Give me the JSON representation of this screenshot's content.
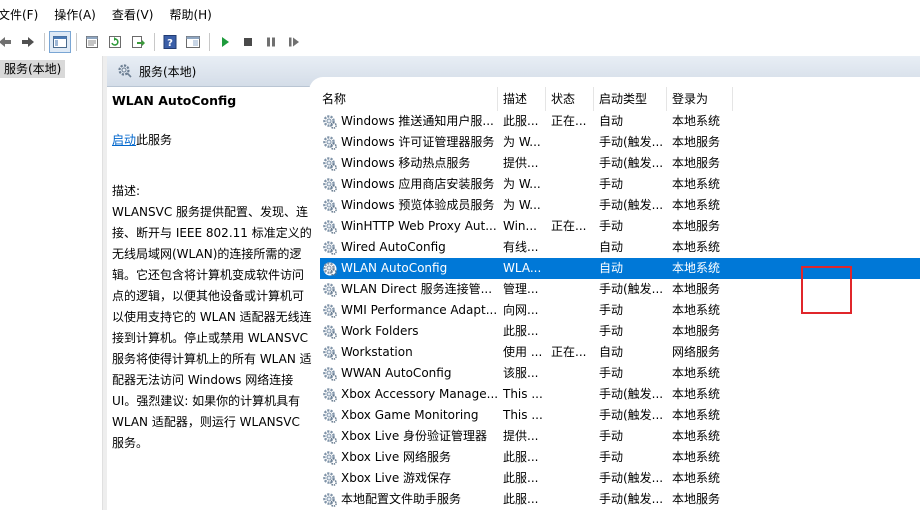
{
  "menubar": {
    "items": [
      "文件(F)",
      "操作(A)",
      "查看(V)",
      "帮助(H)"
    ]
  },
  "toolbar": {
    "icons": [
      "back-icon",
      "forward-icon",
      "show-tree-icon",
      "properties-icon",
      "refresh-icon",
      "export-icon",
      "help-icon",
      "console-icon",
      "play-icon",
      "stop-icon",
      "pause-icon",
      "restart-icon"
    ]
  },
  "tree": {
    "selected_item": "服务(本地)"
  },
  "panel": {
    "header_title": "服务(本地)"
  },
  "description_pane": {
    "service_title": "WLAN AutoConfig",
    "start_link": "启动",
    "start_suffix": "此服务",
    "description_label": "描述:",
    "description_text": "WLANSVC 服务提供配置、发现、连接、断开与 IEEE 802.11 标准定义的无线局域网(WLAN)的连接所需的逻辑。它还包含将计算机变成软件访问点的逻辑，以便其他设备或计算机可以使用支持它的 WLAN 适配器无线连接到计算机。停止或禁用 WLANSVC 服务将使得计算机上的所有 WLAN 适配器无法访问 Windows 网络连接 UI。强烈建议: 如果你的计算机具有 WLAN 适配器，则运行 WLANSVC 服务。"
  },
  "services_table": {
    "columns": [
      "名称",
      "描述",
      "状态",
      "启动类型",
      "登录为"
    ],
    "rows": [
      {
        "name": "Windows 推送通知用户服...",
        "desc": "此服...",
        "status": "正在...",
        "startup": "自动",
        "logon": "本地系统"
      },
      {
        "name": "Windows 许可证管理器服务",
        "desc": "为 W...",
        "status": "",
        "startup": "手动(触发...",
        "logon": "本地服务"
      },
      {
        "name": "Windows 移动热点服务",
        "desc": "提供...",
        "status": "",
        "startup": "手动(触发...",
        "logon": "本地服务"
      },
      {
        "name": "Windows 应用商店安装服务",
        "desc": "为 W...",
        "status": "",
        "startup": "手动",
        "logon": "本地系统"
      },
      {
        "name": "Windows 预览体验成员服务",
        "desc": "为 W...",
        "status": "",
        "startup": "手动(触发...",
        "logon": "本地系统"
      },
      {
        "name": "WinHTTP Web Proxy Aut...",
        "desc": "Win...",
        "status": "正在...",
        "startup": "手动",
        "logon": "本地服务"
      },
      {
        "name": "Wired AutoConfig",
        "desc": "有线...",
        "status": "",
        "startup": "自动",
        "logon": "本地系统"
      },
      {
        "name": "WLAN AutoConfig",
        "desc": "WLA...",
        "status": "",
        "startup": "自动",
        "logon": "本地系统",
        "selected": true
      },
      {
        "name": "WLAN Direct 服务连接管...",
        "desc": "管理...",
        "status": "",
        "startup": "手动(触发...",
        "logon": "本地服务"
      },
      {
        "name": "WMI Performance Adapt...",
        "desc": "向网...",
        "status": "",
        "startup": "手动",
        "logon": "本地系统"
      },
      {
        "name": "Work Folders",
        "desc": "此服...",
        "status": "",
        "startup": "手动",
        "logon": "本地服务"
      },
      {
        "name": "Workstation",
        "desc": "使用 ...",
        "status": "正在...",
        "startup": "自动",
        "logon": "网络服务"
      },
      {
        "name": "WWAN AutoConfig",
        "desc": "该服...",
        "status": "",
        "startup": "手动",
        "logon": "本地系统"
      },
      {
        "name": "Xbox Accessory Manage...",
        "desc": "This ...",
        "status": "",
        "startup": "手动(触发...",
        "logon": "本地系统"
      },
      {
        "name": "Xbox Game Monitoring",
        "desc": "This ...",
        "status": "",
        "startup": "手动(触发...",
        "logon": "本地系统"
      },
      {
        "name": "Xbox Live 身份验证管理器",
        "desc": "提供...",
        "status": "",
        "startup": "手动",
        "logon": "本地系统"
      },
      {
        "name": "Xbox Live 网络服务",
        "desc": "此服...",
        "status": "",
        "startup": "手动",
        "logon": "本地系统"
      },
      {
        "name": "Xbox Live 游戏保存",
        "desc": "此服...",
        "status": "",
        "startup": "手动(触发...",
        "logon": "本地系统"
      },
      {
        "name": "本地配置文件助手服务",
        "desc": "此服...",
        "status": "",
        "startup": "手动(触发...",
        "logon": "本地服务"
      }
    ]
  },
  "colors": {
    "selection": "#0078d7",
    "link": "#0066cc",
    "highlight_box": "#e0262b"
  }
}
